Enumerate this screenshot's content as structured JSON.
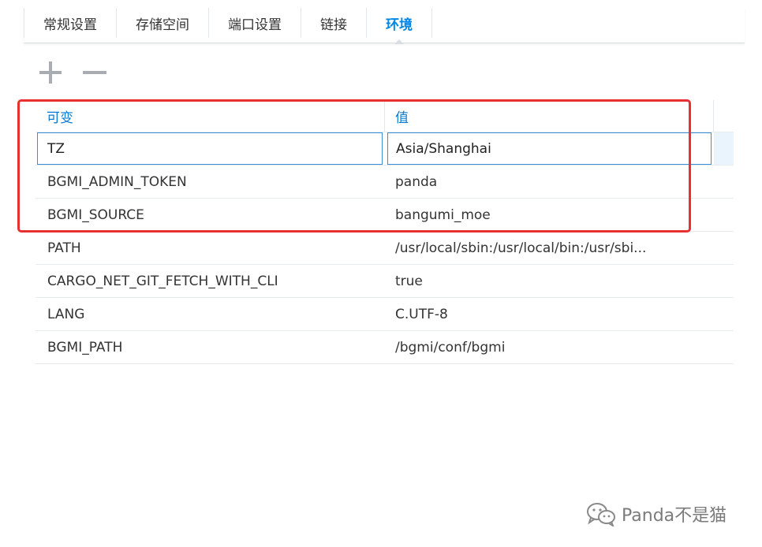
{
  "tabs": [
    {
      "label": "常规设置",
      "active": false
    },
    {
      "label": "存储空间",
      "active": false
    },
    {
      "label": "端口设置",
      "active": false
    },
    {
      "label": "链接",
      "active": false
    },
    {
      "label": "环境",
      "active": true
    }
  ],
  "toolbar": {
    "add_icon": "plus-icon",
    "remove_icon": "minus-icon"
  },
  "table": {
    "headers": {
      "variable": "可变",
      "value": "值"
    },
    "editing_row": {
      "variable": "TZ",
      "value": "Asia/Shanghai"
    },
    "rows": [
      {
        "variable": "BGMI_ADMIN_TOKEN",
        "value": "panda"
      },
      {
        "variable": "BGMI_SOURCE",
        "value": "bangumi_moe"
      },
      {
        "variable": "PATH",
        "value": "/usr/local/sbin:/usr/local/bin:/usr/sbi..."
      },
      {
        "variable": "CARGO_NET_GIT_FETCH_WITH_CLI",
        "value": "true"
      },
      {
        "variable": "LANG",
        "value": "C.UTF-8"
      },
      {
        "variable": "BGMI_PATH",
        "value": "/bgmi/conf/bgmi"
      }
    ]
  },
  "watermark": {
    "text": "Panda不是猫",
    "icon": "wechat-icon"
  },
  "colors": {
    "accent": "#0086e5",
    "highlight": "#e83030",
    "header_text": "#0a7bd1"
  }
}
